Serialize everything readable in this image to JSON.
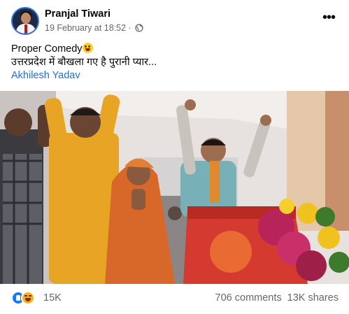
{
  "post": {
    "author": "Pranjal Tiwari",
    "timestamp": "19 February at 18:52",
    "meta_separator": "·",
    "privacy_icon": "globe-icon",
    "more_icon": "more-options-icon",
    "caption_line1": "Proper Comedy",
    "caption_emoji": "zany-face-emoji",
    "caption_line2": "उत्तरप्रदेश में बौखला गए है पुरानी प्यार...",
    "hashtag": "Akhilesh Yadav"
  },
  "engagement": {
    "reaction_icons": [
      "like-icon",
      "haha-icon"
    ],
    "reaction_count": "15K",
    "comments": "706 comments",
    "shares": "13K shares"
  },
  "colors": {
    "link": "#216fdb",
    "secondary_text": "#65676b",
    "like_blue": "#1877f2",
    "haha_yellow": "#f7b125"
  }
}
